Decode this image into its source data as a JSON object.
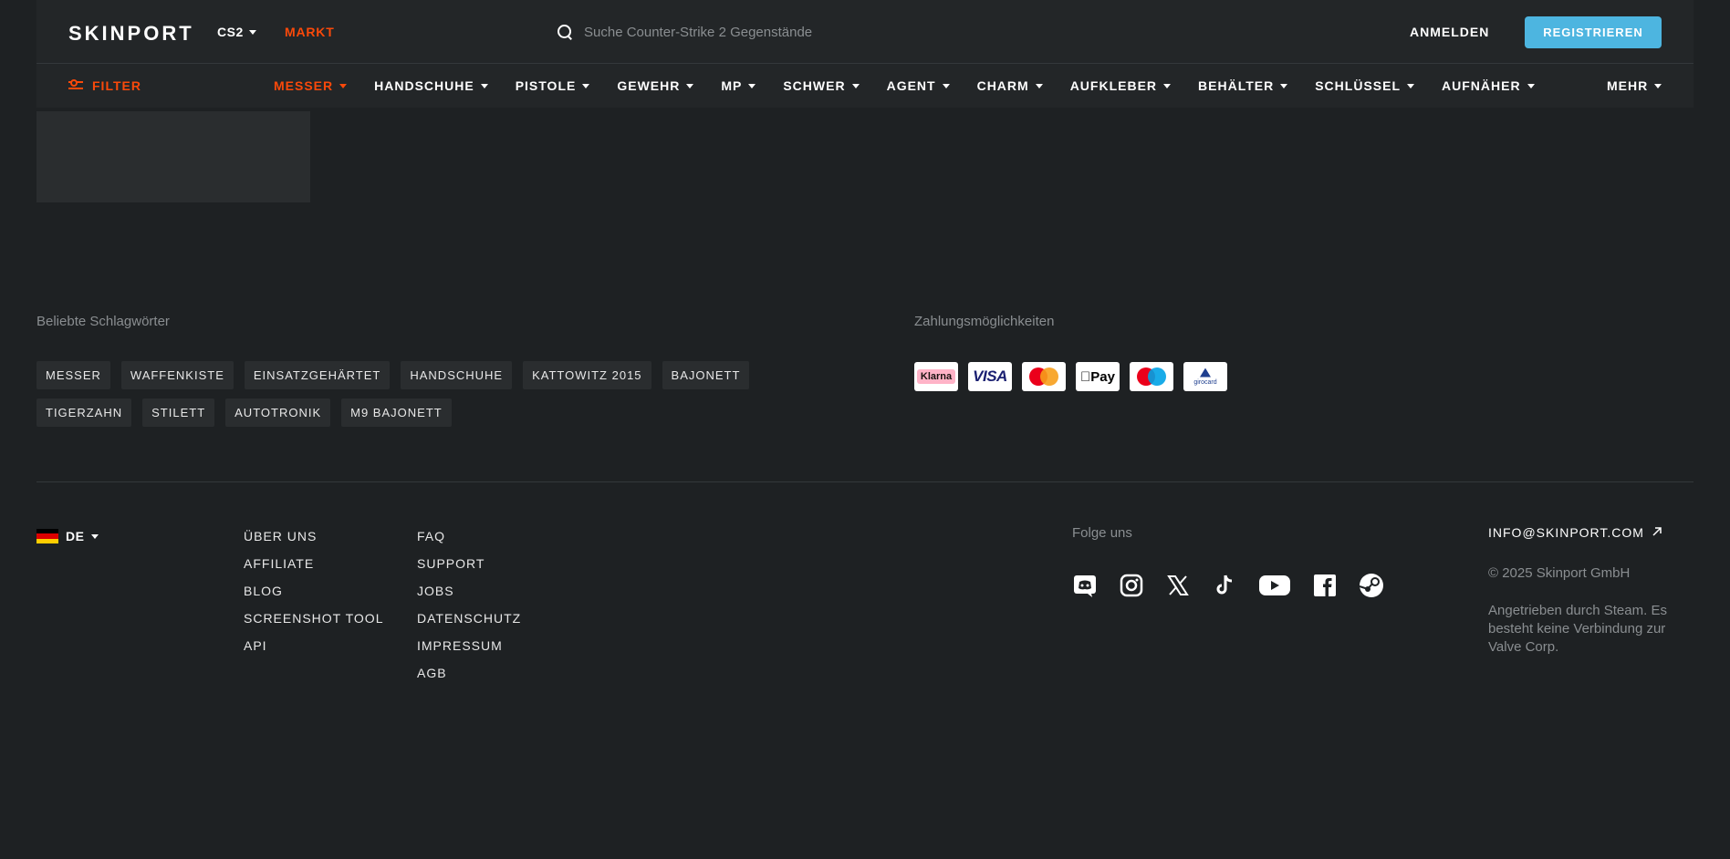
{
  "header": {
    "logo": "SKINPORT",
    "game": "CS2",
    "market": "MARKT",
    "search_placeholder": "Suche Counter-Strike 2 Gegenstände",
    "login": "ANMELDEN",
    "register": "REGISTRIEREN"
  },
  "nav": {
    "filter": "FILTER",
    "categories": [
      "MESSER",
      "HANDSCHUHE",
      "PISTOLE",
      "GEWEHR",
      "MP",
      "SCHWER",
      "AGENT",
      "CHARM",
      "AUFKLEBER",
      "BEHÄLTER",
      "SCHLÜSSEL",
      "AUFNÄHER"
    ],
    "active_category": "MESSER",
    "more": "MEHR"
  },
  "tags": {
    "title": "Beliebte Schlagwörter",
    "row1": [
      "MESSER",
      "WAFFENKISTE",
      "EINSATZGEHÄRTET",
      "HANDSCHUHE",
      "KATTOWITZ 2015",
      "BAJONETT"
    ],
    "row2": [
      "TIGERZAHN",
      "STILETT",
      "AUTOTRONIK",
      "M9 BAJONETT"
    ]
  },
  "payments": {
    "title": "Zahlungsmöglichkeiten",
    "methods": [
      "Klarna",
      "VISA",
      "Mastercard",
      "Apple Pay",
      "Maestro",
      "giropay"
    ],
    "klarna_label": "Klarna",
    "visa_label": "VISA",
    "applepay_label": "Pay",
    "giro_label": "girocard"
  },
  "footer": {
    "language": "DE",
    "links_col1": [
      "ÜBER UNS",
      "AFFILIATE",
      "BLOG",
      "SCREENSHOT TOOL",
      "API"
    ],
    "links_col2": [
      "FAQ",
      "SUPPORT",
      "JOBS",
      "DATENSCHUTZ",
      "IMPRESSUM",
      "AGB"
    ],
    "follow_title": "Folge uns",
    "socials": [
      "discord-icon",
      "instagram-icon",
      "x-icon",
      "tiktok-icon",
      "youtube-icon",
      "facebook-icon",
      "steam-icon"
    ],
    "email": "INFO@SKINPORT.COM",
    "copyright": "© 2025 Skinport GmbH",
    "powered": "Angetrieben durch Steam. Es besteht keine Verbindung zur Valve Corp."
  },
  "colors": {
    "accent": "#fa490a",
    "register": "#4db5e0",
    "background": "#1e2123",
    "header": "#232628"
  }
}
